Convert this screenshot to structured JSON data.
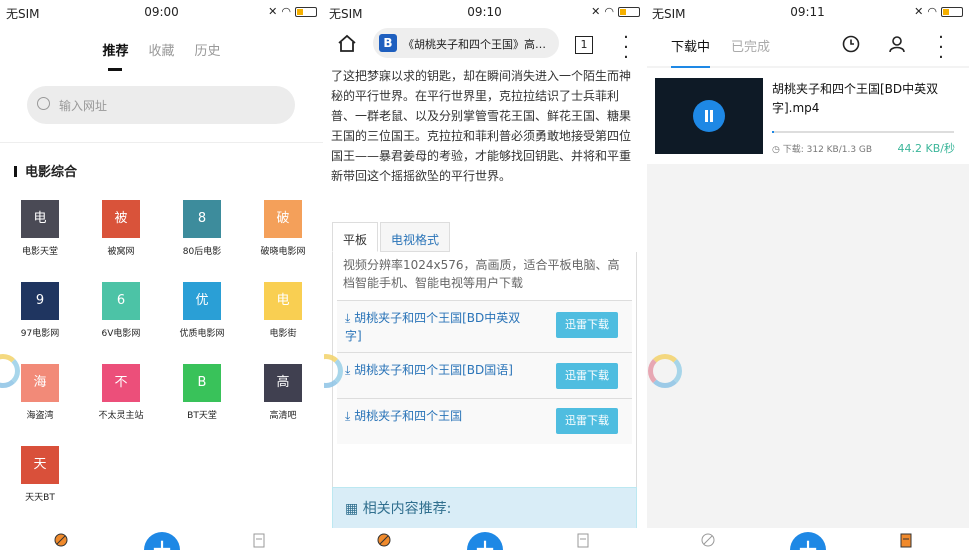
{
  "panel1": {
    "status": {
      "carrier": "无SIM",
      "time": "09:00"
    },
    "tabs": [
      "推荐",
      "收藏",
      "历史"
    ],
    "url_placeholder": "输入网址",
    "section_title": "电影综合",
    "sites": [
      {
        "glyph": "电",
        "label": "电影天堂",
        "color": "#4a4a55"
      },
      {
        "glyph": "被",
        "label": "被窝网",
        "color": "#d9533a"
      },
      {
        "glyph": "8",
        "label": "80后电影",
        "color": "#3d8c9c"
      },
      {
        "glyph": "破",
        "label": "破晓电影网",
        "color": "#f4a05a"
      },
      {
        "glyph": "9",
        "label": "97电影网",
        "color": "#1f3560"
      },
      {
        "glyph": "6",
        "label": "6V电影网",
        "color": "#4cc3a6"
      },
      {
        "glyph": "优",
        "label": "优质电影网",
        "color": "#2a9fd6"
      },
      {
        "glyph": "电",
        "label": "电影街",
        "color": "#f9cf52"
      },
      {
        "glyph": "海",
        "label": "海盗湾",
        "color": "#f28a78"
      },
      {
        "glyph": "不",
        "label": "不太灵主站",
        "color": "#ec4f7a"
      },
      {
        "glyph": "B",
        "label": "BT天堂",
        "color": "#39c25a"
      },
      {
        "glyph": "高",
        "label": "高清吧",
        "color": "#404050"
      },
      {
        "glyph": "天",
        "label": "天天BT",
        "color": "#d9503a"
      }
    ]
  },
  "panel2": {
    "status": {
      "carrier": "无SIM",
      "time": "09:10"
    },
    "address": "《胡桃夹子和四个王国》高…",
    "tab_count": "1",
    "article": "了这把梦寐以求的钥匙，却在瞬间消失进入一个陌生而神秘的平行世界。在平行世界里，克拉拉结识了士兵菲利普、一群老鼠、以及分别掌管雪花王国、鲜花王国、糖果王国的三位国王。克拉拉和菲利普必须勇敢地接受第四位国王——暴君姜母的考验，才能够找回钥匙、并将和平重新带回这个摇摇欲坠的平行世界。",
    "format_tabs": [
      "平板",
      "电视格式"
    ],
    "format_desc": "视频分辨率1024x576，高画质，适合平板电脑、高档智能手机、智能电视等用户下载",
    "downloads": [
      {
        "title": "胡桃夹子和四个王国[BD中英双字]",
        "button": "迅雷下载"
      },
      {
        "title": "胡桃夹子和四个王国[BD国语]",
        "button": "迅雷下载"
      },
      {
        "title": "胡桃夹子和四个王国",
        "button": "迅雷下载"
      }
    ],
    "related": "相关内容推荐:"
  },
  "panel3": {
    "status": {
      "carrier": "无SIM",
      "time": "09:11"
    },
    "tabs": [
      "下载中",
      "已完成"
    ],
    "file_name": "胡桃夹子和四个王国[BD中英双字].mp4",
    "size": "下载: 312 KB/1.3 GB",
    "speed": "44.2 KB/秒",
    "progress": 0.0002
  },
  "colors": {
    "accent": "#1e88e5",
    "speed": "#3cb69a",
    "link": "#2a74b8",
    "button": "#4fbde0"
  }
}
